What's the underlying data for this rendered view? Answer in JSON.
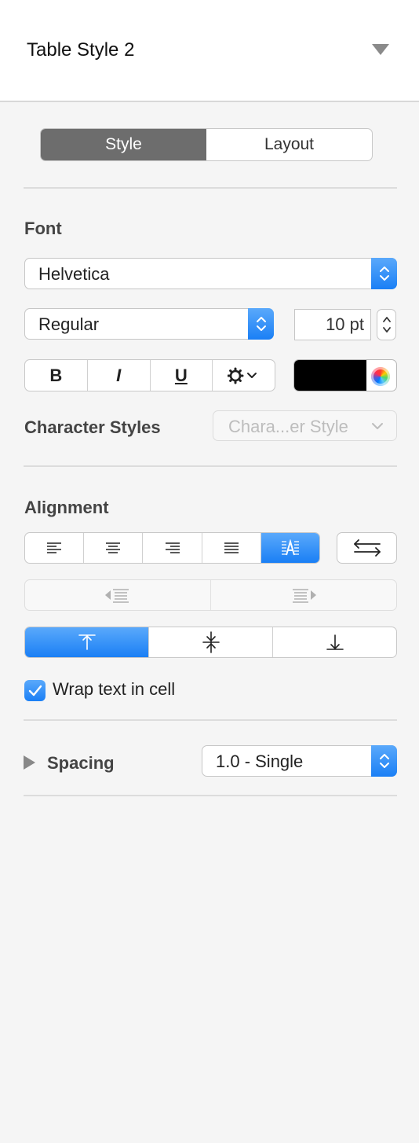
{
  "header": {
    "title": "Table Style 2"
  },
  "tabs": [
    {
      "label": "Style",
      "active": true
    },
    {
      "label": "Layout",
      "active": false
    }
  ],
  "font": {
    "section_label": "Font",
    "family": "Helvetica",
    "typeface": "Regular",
    "size": "10 pt",
    "bold_label": "B",
    "italic_label": "I",
    "underline_label": "U",
    "text_color": "#000000"
  },
  "character_styles": {
    "label": "Character Styles",
    "value": "Chara...er Style"
  },
  "alignment": {
    "section_label": "Alignment",
    "horizontal_selected": "auto-align",
    "vertical_selected": "top"
  },
  "wrap": {
    "label": "Wrap text in cell",
    "checked": true
  },
  "spacing": {
    "label": "Spacing",
    "value": "1.0 - Single"
  },
  "colors": {
    "accent": "#1a7ff5",
    "segment_selected": "#6d6d6d"
  }
}
